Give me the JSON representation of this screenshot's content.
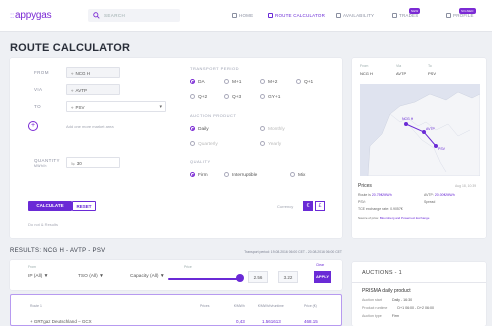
{
  "app": {
    "logo": "appygas",
    "logo_mark": "::"
  },
  "search": {
    "label": "SEARCH"
  },
  "nav": [
    {
      "label": "HOME",
      "icon": "home-icon"
    },
    {
      "label": "ROUTE CALCULATOR",
      "icon": "route-icon",
      "active": true
    },
    {
      "label": "AVAILABILITY",
      "icon": "availability-icon"
    },
    {
      "label": "TRADES",
      "icon": "trades-icon",
      "badge": "NEW"
    },
    {
      "label": "PROFILE",
      "icon": "profile-icon",
      "badge": "SIGNED"
    }
  ],
  "page": {
    "title": "ROUTE CALCULATOR"
  },
  "form": {
    "from_label": "FROM",
    "from_value": "NCG H",
    "via_label": "VIA",
    "via_value": "AVTP",
    "to_label": "TO",
    "to_value": "PSV",
    "add_hint": "Add one more market area",
    "quantity_label": "QUANTITY",
    "quantity_unit": "MWh/h",
    "quantity_value": "30",
    "transport_title": "TRANSPORT PERIOD",
    "transport_options": [
      "DA",
      "M+1",
      "M+2",
      "Q+1",
      "Q+2",
      "Q+3",
      "GY+1"
    ],
    "auction_title": "AUCTION PRODUCT",
    "auction_options": [
      "Daily",
      "Monthly",
      "Quarterly",
      "Yearly"
    ],
    "quality_title": "QUALITY",
    "quality_options": [
      "Firm",
      "Interruptible",
      "Mix"
    ],
    "calculate_label": "CALCULATE",
    "reset_label": "RESET",
    "footer_link": "Do not & Results",
    "currency_label": "Currency",
    "currency_a": "€",
    "currency_b": "£"
  },
  "map_panel": {
    "col1_head": "From",
    "col1_val": "NCG H",
    "col2_head": "Via",
    "col2_val": "AVTP",
    "col3_head": "To",
    "col3_val": "PSV",
    "prices_title": "Prices",
    "prices_date": "Aug 18, 10:39",
    "price_line1_label": "Route is",
    "price_line1_val": "20.75€/MWh",
    "price_line1b_label": "AVTP:",
    "price_line1b_val": "20.00€/MWh",
    "price_line2_label": "PSV:",
    "price_line2b": "Spread",
    "price_line3": "TCE exchange rate: 0.9057€",
    "price_line4_label": "Source of price:",
    "price_line4_val": "Bloomberg and Powernext Exchange"
  },
  "results": {
    "title": "RESULTS: NCG H - AVTP - PSV",
    "meta": "Transport period: 19.08.2016 06:00 CET - 20.08.2016 06:00 CET"
  },
  "filters": {
    "from_label": "From",
    "from_value": "IP (All)",
    "tso_value": "TSO (All)",
    "capacity_value": "Capacity (All)",
    "price_label": "Price",
    "price_min": "2.56",
    "price_max": "3.22",
    "clear_label": "Clear",
    "apply_label": "APPLY"
  },
  "table": {
    "route_head": "Route 1",
    "prices_head": "Prices",
    "col_a_head": "€/MWh",
    "col_b_head": "€/MWh/h/runtime",
    "col_c_head": "Price (€)",
    "row_label": "+ GRTgaz Deutschland – GCX",
    "row_val_a": "0,43",
    "row_val_b": "1.561613",
    "row_val_c": "468.15"
  },
  "auctions": {
    "title": "AUCTIONS - 1",
    "name": "PRISMA daily product",
    "start_label": "Auction start",
    "start_value": "Daily - 16:30",
    "runtime_label": "Product runtime",
    "runtime_value": "D+1 06:00 - D+2 06:00",
    "last_label": "Auction type",
    "last_value": "Firm"
  },
  "colors": {
    "accent": "#6a2ad6",
    "accent_light": "#b79af0",
    "background": "#eef0f4"
  }
}
